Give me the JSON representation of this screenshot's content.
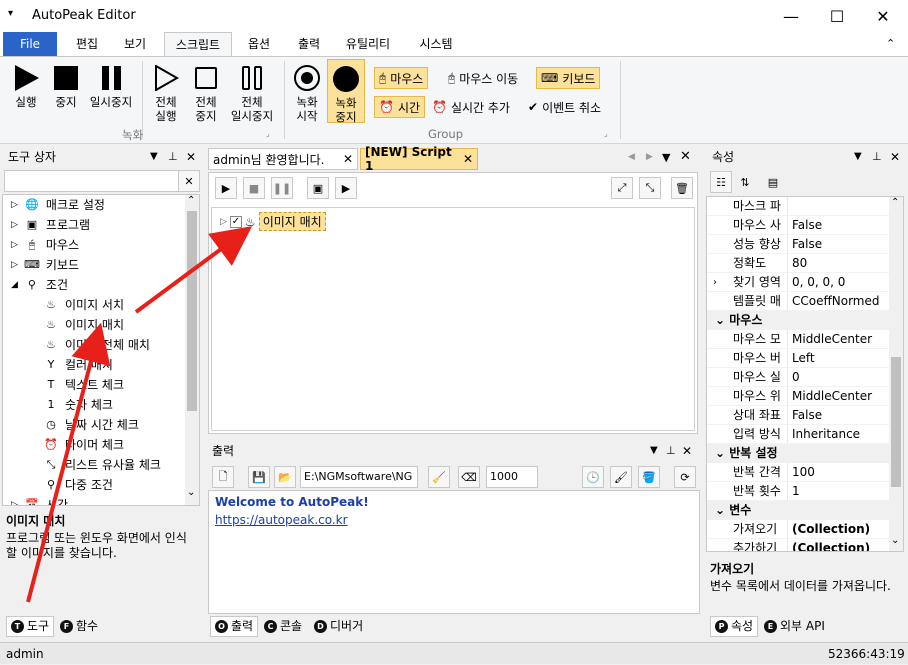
{
  "app": {
    "title": "AutoPeak Editor"
  },
  "window": {
    "minimize": "—",
    "maximize": "☐",
    "close": "✕"
  },
  "menu": {
    "file": "File",
    "tabs": [
      "편집",
      "보기",
      "스크립트",
      "옵션",
      "출력",
      "유틸리티",
      "시스템"
    ]
  },
  "ribbon": {
    "run": "실행",
    "stop": "중지",
    "pause": "일시중지",
    "all_run_1": "전체",
    "all_run_2": "실행",
    "all_stop_1": "전체",
    "all_stop_2": "중지",
    "all_pause_1": "전체",
    "all_pause_2": "일시중지",
    "rec_start_1": "녹화",
    "rec_start_2": "시작",
    "rec_stop_1": "녹화",
    "rec_stop_2": "중지",
    "group_record": "녹화",
    "mouse": "마우스",
    "mouse_move": "마우스 이동",
    "keyboard": "키보드",
    "time": "시간",
    "realtime_add": "실시간 추가",
    "event_cancel": "이벤트 취소",
    "group_group": "Group"
  },
  "toolbox": {
    "title": "도구 상자",
    "items": [
      {
        "label": "매크로 설정",
        "icon": "globe-icon"
      },
      {
        "label": "프로그램",
        "icon": "program-icon"
      },
      {
        "label": "마우스",
        "icon": "mouse-icon"
      },
      {
        "label": "키보드",
        "icon": "keyboard-icon"
      },
      {
        "label": "조건",
        "icon": "condition-icon"
      }
    ],
    "children": [
      {
        "label": "이미지 서치",
        "icon": "image-search-icon"
      },
      {
        "label": "이미지 매치",
        "icon": "image-match-icon"
      },
      {
        "label": "이미지 전체 매치",
        "icon": "image-match-all-icon"
      },
      {
        "label": "컬러 매치",
        "icon": "color-match-icon"
      },
      {
        "label": "텍스트 체크",
        "icon": "text-check-icon"
      },
      {
        "label": "숫자 체크",
        "icon": "number-check-icon"
      },
      {
        "label": "날짜 시간 체크",
        "icon": "clock-icon"
      },
      {
        "label": "타이머 체크",
        "icon": "alarm-icon"
      },
      {
        "label": "리스트 유사율 체크",
        "icon": "list-similarity-icon"
      },
      {
        "label": "다중 조건",
        "icon": "multi-condition-icon"
      }
    ],
    "next_item": "시간",
    "desc_title": "이미지 매치",
    "desc_text": "프로그램 또는 윈도우 화면에서 인식할 이미지를 찾습니다.",
    "tab_tools": "도구",
    "tab_functions": "함수"
  },
  "editor": {
    "tab_welcome": "admin님 환영합니다.",
    "tab_script": "[NEW] Script 1",
    "node_label": "이미지 매치"
  },
  "output": {
    "title": "출력",
    "path": "E:\\NGMsoftware\\NG",
    "count": "1000",
    "welcome": "Welcome to AutoPeak!",
    "link": "https://autopeak.co.kr",
    "tab_output": "출력",
    "tab_console": "콘솔",
    "tab_debugger": "디버거"
  },
  "properties": {
    "title": "속성",
    "rows_top": [
      {
        "name": "마스크 파",
        "value": ""
      },
      {
        "name": "마우스 사",
        "value": "False"
      },
      {
        "name": "성능 향상",
        "value": "False"
      },
      {
        "name": "정확도",
        "value": "80"
      },
      {
        "name": "찾기 영역",
        "value": "0, 0, 0, 0"
      },
      {
        "name": "템플릿 매",
        "value": "CCoeffNormed"
      }
    ],
    "cat_mouse": "마우스",
    "rows_mouse": [
      {
        "name": "마우스 모",
        "value": "MiddleCenter"
      },
      {
        "name": "마우스 버",
        "value": "Left"
      },
      {
        "name": "마우스 실",
        "value": "0"
      },
      {
        "name": "마우스 위",
        "value": "MiddleCenter"
      },
      {
        "name": "상대 좌표",
        "value": "False"
      },
      {
        "name": "입력 방식",
        "value": "Inheritance"
      }
    ],
    "cat_repeat": "반복 설정",
    "rows_repeat": [
      {
        "name": "반복 간격",
        "value": "100"
      },
      {
        "name": "반복 횟수",
        "value": "1"
      }
    ],
    "cat_var": "변수",
    "rows_var": [
      {
        "name": "가져오기",
        "value": "(Collection)"
      },
      {
        "name": "추가하기",
        "value": "(Collection)"
      }
    ],
    "desc_title": "가져오기",
    "desc_text": "변수 목록에서 데이터를 가져옵니다.",
    "tab_props": "속성",
    "tab_api": "외부 API"
  },
  "status": {
    "user": "admin",
    "time": "52366:43:19"
  },
  "colors": {
    "accent": "#2a64c8",
    "highlight": "#fbe19a",
    "arrow": "#e8201a"
  }
}
